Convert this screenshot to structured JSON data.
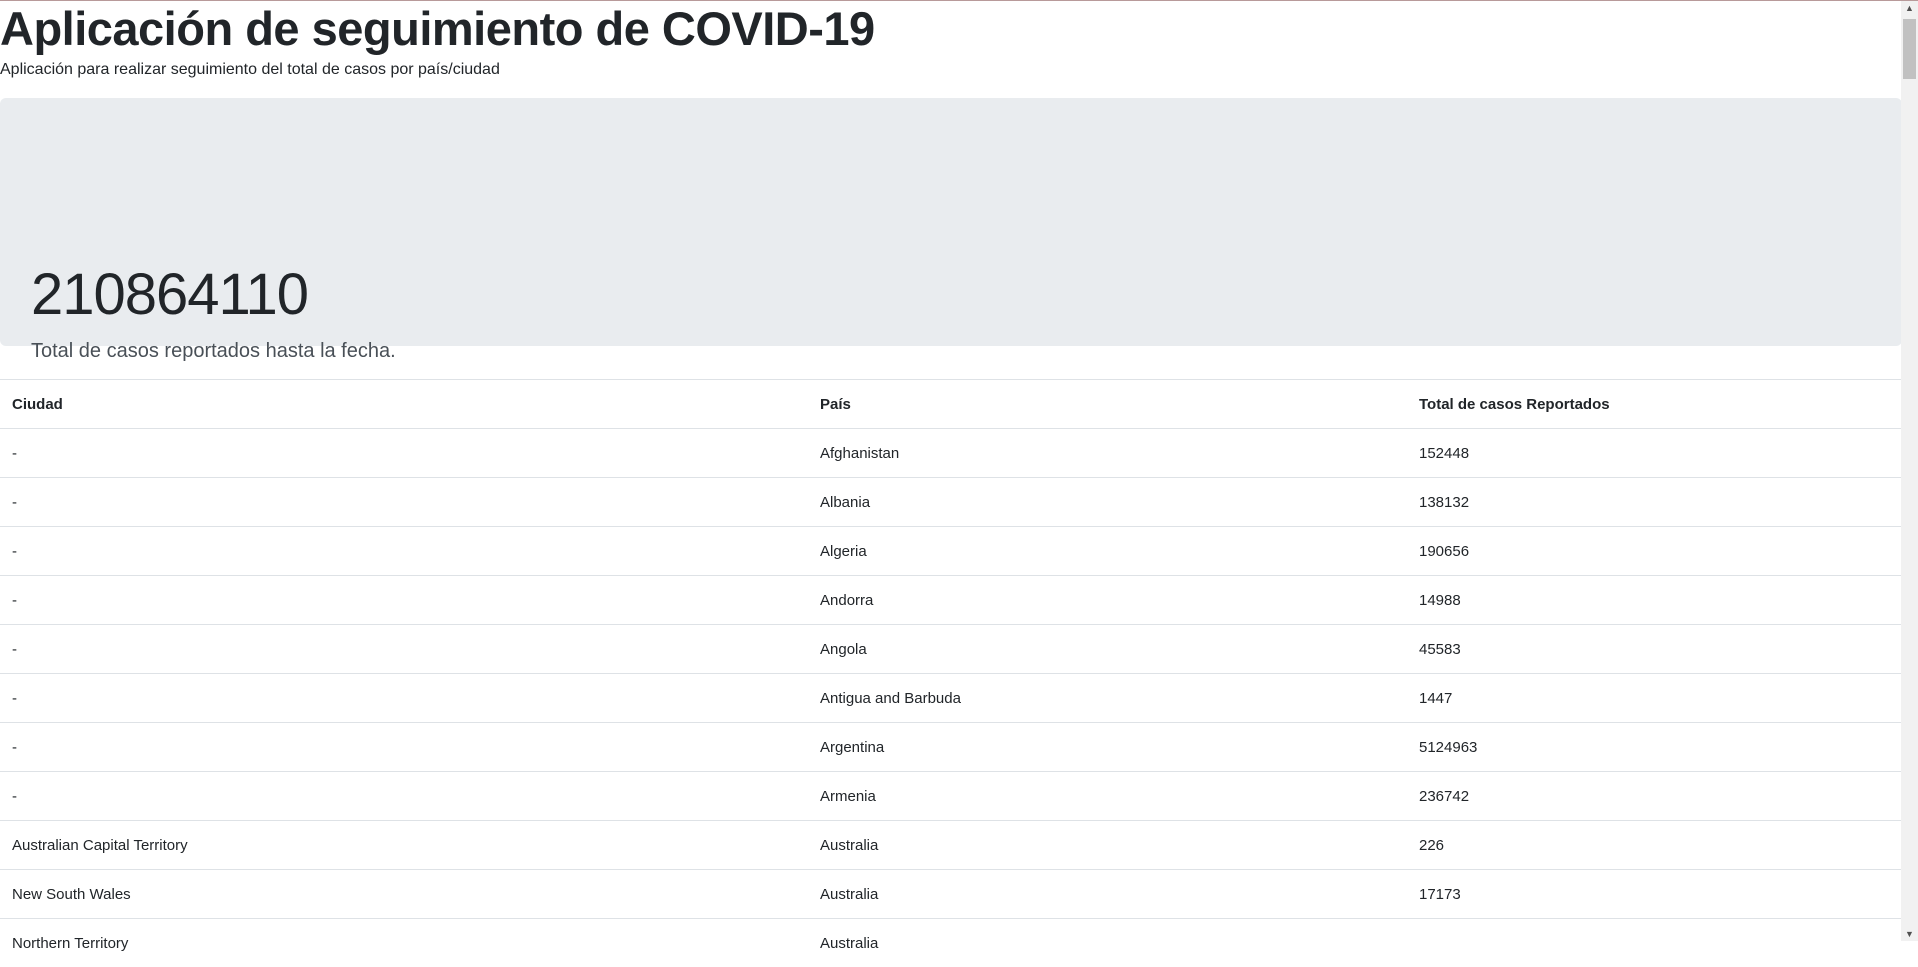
{
  "header": {
    "title": "Aplicación de seguimiento de COVID-19",
    "subtitle": "Aplicación para realizar seguimiento del total de casos por país/ciudad"
  },
  "summary": {
    "total": "210864110",
    "caption": "Total de casos reportados hasta la fecha."
  },
  "table": {
    "headers": [
      "Ciudad",
      "País",
      "Total de casos Reportados"
    ],
    "rows": [
      [
        "-",
        "Afghanistan",
        "152448"
      ],
      [
        "-",
        "Albania",
        "138132"
      ],
      [
        "-",
        "Algeria",
        "190656"
      ],
      [
        "-",
        "Andorra",
        "14988"
      ],
      [
        "-",
        "Angola",
        "45583"
      ],
      [
        "-",
        "Antigua and Barbuda",
        "1447"
      ],
      [
        "-",
        "Argentina",
        "5124963"
      ],
      [
        "-",
        "Armenia",
        "236742"
      ],
      [
        "Australian Capital Territory",
        "Australia",
        "226"
      ],
      [
        "New South Wales",
        "Australia",
        "17173"
      ],
      [
        "Northern Territory",
        "Australia",
        ""
      ]
    ]
  },
  "colors": {
    "jumbotron": "#e9ecef",
    "text": "#212529",
    "border": "#dee2e6"
  }
}
